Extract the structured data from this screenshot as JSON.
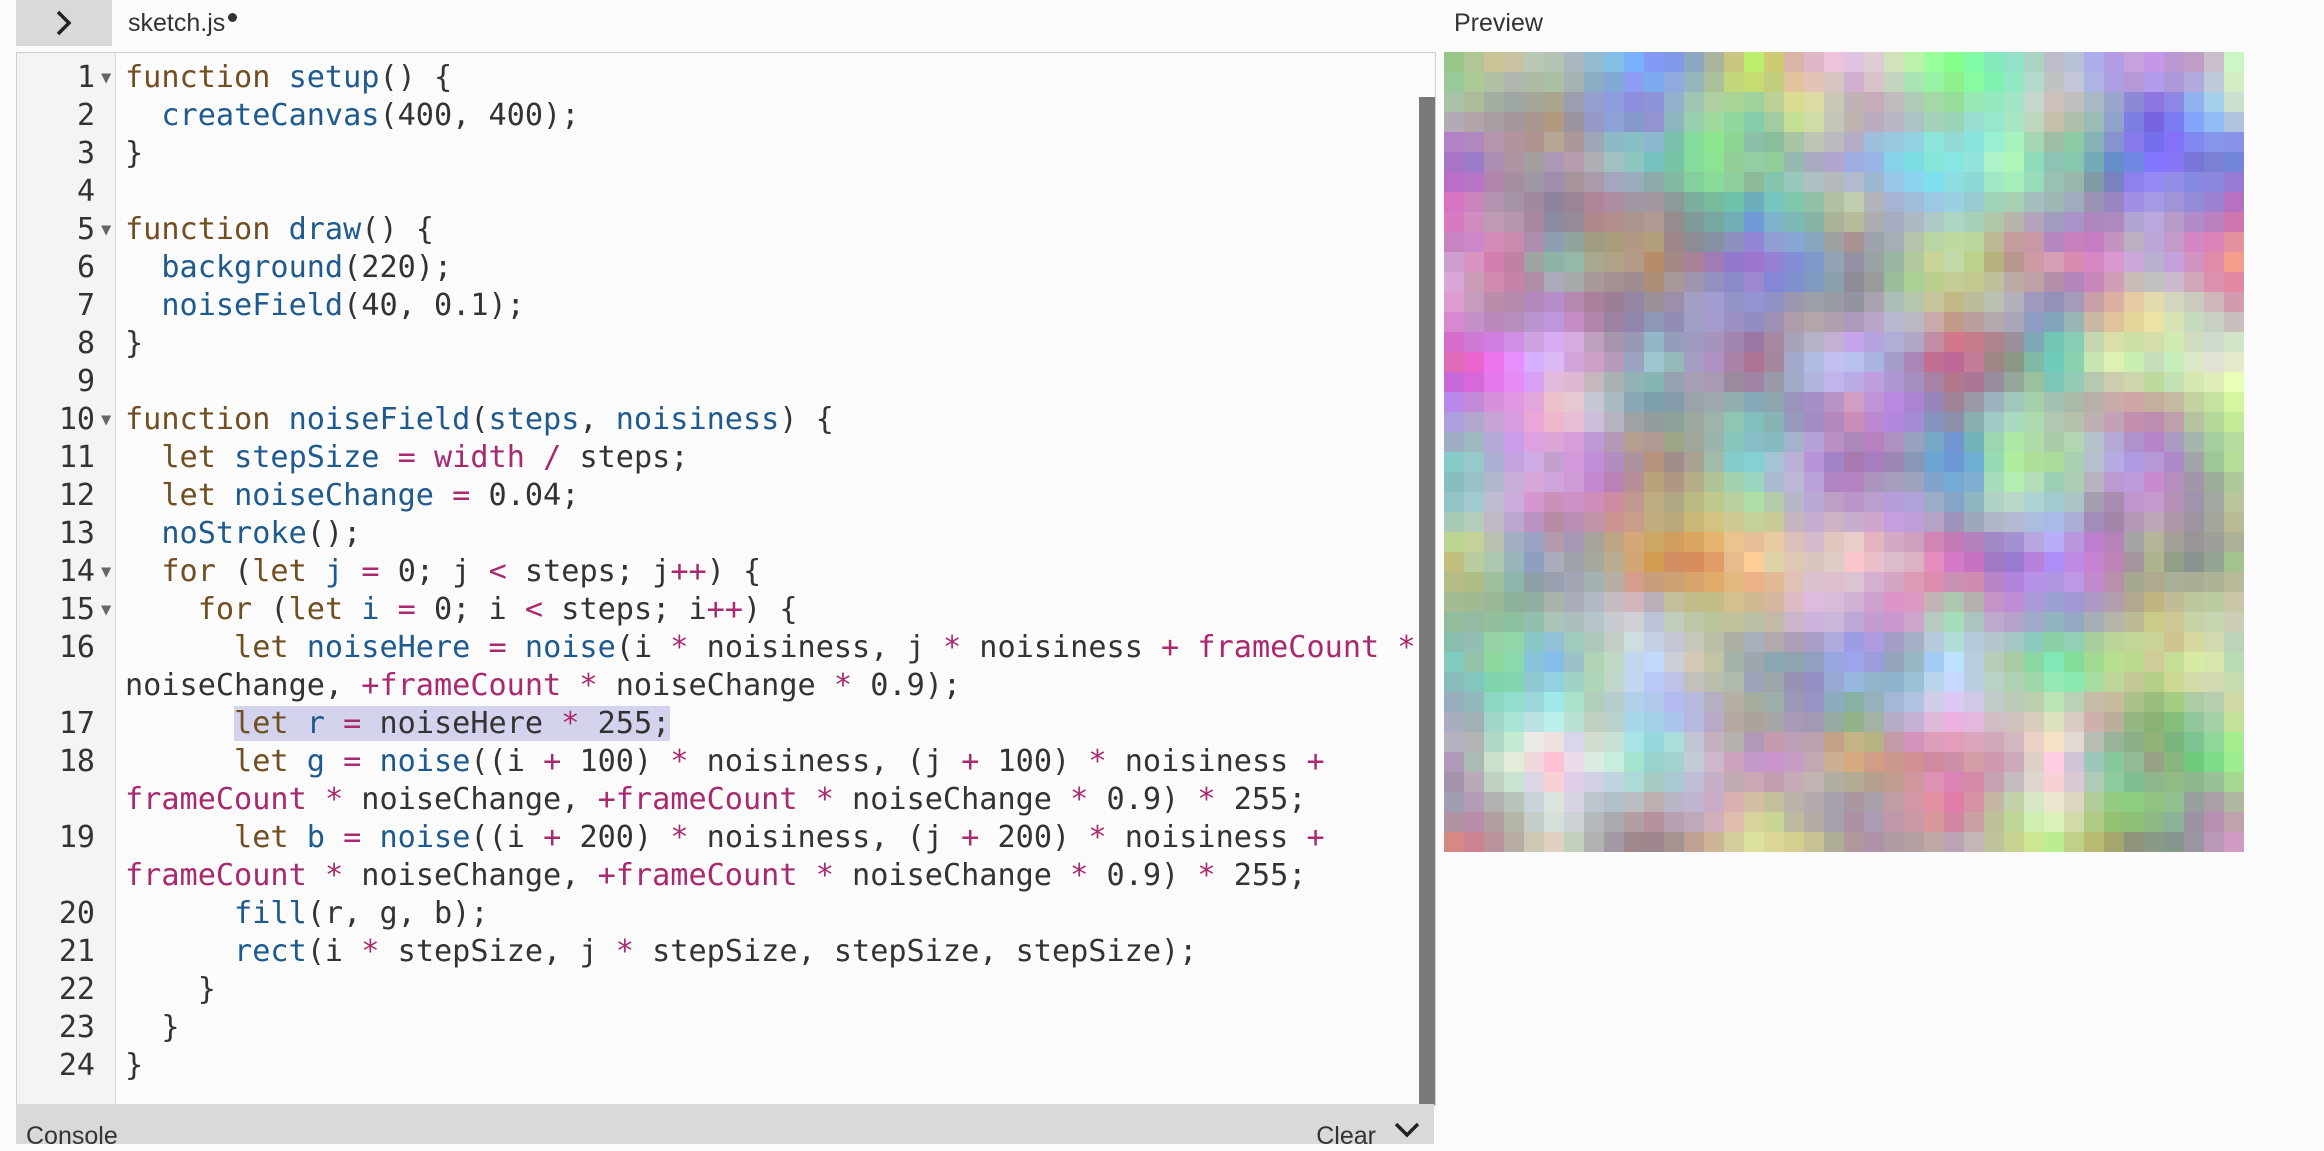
{
  "header": {
    "file_name": "sketch.js",
    "preview_label": "Preview"
  },
  "console": {
    "label": "Console",
    "clear_label": "Clear"
  },
  "editor": {
    "highlighted_line": 17,
    "lines": [
      {
        "n": "1",
        "fold": true,
        "t": [
          [
            "k",
            "function "
          ],
          [
            "f",
            "setup"
          ],
          [
            "",
            "() {"
          ]
        ]
      },
      {
        "n": "2",
        "t": [
          [
            "",
            "  "
          ],
          [
            "f",
            "createCanvas"
          ],
          [
            "",
            "(400, 400);"
          ]
        ]
      },
      {
        "n": "3",
        "t": [
          [
            "",
            "}"
          ]
        ]
      },
      {
        "n": "4",
        "t": []
      },
      {
        "n": "5",
        "fold": true,
        "t": [
          [
            "k",
            "function "
          ],
          [
            "f",
            "draw"
          ],
          [
            "",
            "() {"
          ]
        ]
      },
      {
        "n": "6",
        "t": [
          [
            "",
            "  "
          ],
          [
            "f",
            "background"
          ],
          [
            "",
            "(220);"
          ]
        ]
      },
      {
        "n": "7",
        "t": [
          [
            "",
            "  "
          ],
          [
            "f",
            "noiseField"
          ],
          [
            "",
            "(40, 0.1);"
          ]
        ]
      },
      {
        "n": "8",
        "t": [
          [
            "",
            "}"
          ]
        ]
      },
      {
        "n": "9",
        "t": []
      },
      {
        "n": "10",
        "fold": true,
        "t": [
          [
            "k",
            "function "
          ],
          [
            "f",
            "noiseField"
          ],
          [
            "",
            "("
          ],
          [
            "f",
            "steps"
          ],
          [
            "",
            ", "
          ],
          [
            "f",
            "noisiness"
          ],
          [
            "",
            ") {"
          ]
        ]
      },
      {
        "n": "11",
        "t": [
          [
            "",
            "  "
          ],
          [
            "k",
            "let "
          ],
          [
            "f",
            "stepSize"
          ],
          [
            "",
            " "
          ],
          [
            "p",
            "="
          ],
          [
            "",
            " "
          ],
          [
            "p",
            "width"
          ],
          [
            "",
            " "
          ],
          [
            "p",
            "/"
          ],
          [
            "",
            " steps;"
          ]
        ]
      },
      {
        "n": "12",
        "t": [
          [
            "",
            "  "
          ],
          [
            "k",
            "let "
          ],
          [
            "f",
            "noiseChange"
          ],
          [
            "",
            " "
          ],
          [
            "p",
            "="
          ],
          [
            "",
            " 0.04;"
          ]
        ]
      },
      {
        "n": "13",
        "t": [
          [
            "",
            "  "
          ],
          [
            "f",
            "noStroke"
          ],
          [
            "",
            "();"
          ]
        ]
      },
      {
        "n": "14",
        "fold": true,
        "t": [
          [
            "",
            "  "
          ],
          [
            "k",
            "for"
          ],
          [
            "",
            " ("
          ],
          [
            "k",
            "let "
          ],
          [
            "f",
            "j"
          ],
          [
            "",
            " "
          ],
          [
            "p",
            "="
          ],
          [
            "",
            " 0; j "
          ],
          [
            "p",
            "<"
          ],
          [
            "",
            " steps; j"
          ],
          [
            "p",
            "++"
          ],
          [
            "",
            ") {"
          ]
        ]
      },
      {
        "n": "15",
        "fold": true,
        "t": [
          [
            "",
            "    "
          ],
          [
            "k",
            "for"
          ],
          [
            "",
            " ("
          ],
          [
            "k",
            "let "
          ],
          [
            "f",
            "i"
          ],
          [
            "",
            " "
          ],
          [
            "p",
            "="
          ],
          [
            "",
            " 0; i "
          ],
          [
            "p",
            "<"
          ],
          [
            "",
            " steps; i"
          ],
          [
            "p",
            "++"
          ],
          [
            "",
            ") {"
          ]
        ]
      },
      {
        "n": "16",
        "t": [
          [
            "",
            "      "
          ],
          [
            "k",
            "let "
          ],
          [
            "f",
            "noiseHere"
          ],
          [
            "",
            " "
          ],
          [
            "p",
            "="
          ],
          [
            "",
            " "
          ],
          [
            "f",
            "noise"
          ],
          [
            "",
            "(i "
          ],
          [
            "p",
            "*"
          ],
          [
            "",
            " noisiness, j "
          ],
          [
            "p",
            "*"
          ],
          [
            "",
            " noisiness "
          ],
          [
            "p",
            "+"
          ],
          [
            "",
            " "
          ],
          [
            "p",
            "frameCount"
          ],
          [
            "",
            " "
          ],
          [
            "p",
            "*"
          ]
        ],
        "c": [
          [
            "",
            "noiseChange, "
          ],
          [
            "p",
            "+frameCount"
          ],
          [
            "",
            " "
          ],
          [
            "p",
            "*"
          ],
          [
            "",
            " noiseChange "
          ],
          [
            "p",
            "*"
          ],
          [
            "",
            " 0.9);"
          ]
        ]
      },
      {
        "n": "17",
        "t": [
          [
            "",
            "      "
          ],
          [
            "k",
            "let "
          ],
          [
            "f",
            "r"
          ],
          [
            "",
            " "
          ],
          [
            "p",
            "="
          ],
          [
            "",
            " noiseHere "
          ],
          [
            "p",
            "*"
          ],
          [
            "",
            " 255;"
          ]
        ]
      },
      {
        "n": "18",
        "t": [
          [
            "",
            "      "
          ],
          [
            "k",
            "let "
          ],
          [
            "f",
            "g"
          ],
          [
            "",
            " "
          ],
          [
            "p",
            "="
          ],
          [
            "",
            " "
          ],
          [
            "f",
            "noise"
          ],
          [
            "",
            "((i "
          ],
          [
            "p",
            "+"
          ],
          [
            "",
            " 100) "
          ],
          [
            "p",
            "*"
          ],
          [
            "",
            " noisiness, (j "
          ],
          [
            "p",
            "+"
          ],
          [
            "",
            " 100) "
          ],
          [
            "p",
            "*"
          ],
          [
            "",
            " noisiness "
          ],
          [
            "p",
            "+"
          ]
        ],
        "c": [
          [
            "p",
            "frameCount"
          ],
          [
            "",
            " "
          ],
          [
            "p",
            "*"
          ],
          [
            "",
            " noiseChange, "
          ],
          [
            "p",
            "+frameCount"
          ],
          [
            "",
            " "
          ],
          [
            "p",
            "*"
          ],
          [
            "",
            " noiseChange "
          ],
          [
            "p",
            "*"
          ],
          [
            "",
            " 0.9) "
          ],
          [
            "p",
            "*"
          ],
          [
            "",
            " 255;"
          ]
        ]
      },
      {
        "n": "19",
        "t": [
          [
            "",
            "      "
          ],
          [
            "k",
            "let "
          ],
          [
            "f",
            "b"
          ],
          [
            "",
            " "
          ],
          [
            "p",
            "="
          ],
          [
            "",
            " "
          ],
          [
            "f",
            "noise"
          ],
          [
            "",
            "((i "
          ],
          [
            "p",
            "+"
          ],
          [
            "",
            " 200) "
          ],
          [
            "p",
            "*"
          ],
          [
            "",
            " noisiness, (j "
          ],
          [
            "p",
            "+"
          ],
          [
            "",
            " 200) "
          ],
          [
            "p",
            "*"
          ],
          [
            "",
            " noisiness "
          ],
          [
            "p",
            "+"
          ]
        ],
        "c": [
          [
            "p",
            "frameCount"
          ],
          [
            "",
            " "
          ],
          [
            "p",
            "*"
          ],
          [
            "",
            " noiseChange, "
          ],
          [
            "p",
            "+frameCount"
          ],
          [
            "",
            " "
          ],
          [
            "p",
            "*"
          ],
          [
            "",
            " noiseChange "
          ],
          [
            "p",
            "*"
          ],
          [
            "",
            " 0.9) "
          ],
          [
            "p",
            "*"
          ],
          [
            "",
            " 255;"
          ]
        ]
      },
      {
        "n": "20",
        "t": [
          [
            "",
            "      "
          ],
          [
            "f",
            "fill"
          ],
          [
            "",
            "(r, g, b);"
          ]
        ]
      },
      {
        "n": "21",
        "t": [
          [
            "",
            "      "
          ],
          [
            "f",
            "rect"
          ],
          [
            "",
            "(i "
          ],
          [
            "p",
            "*"
          ],
          [
            "",
            " stepSize, j "
          ],
          [
            "p",
            "*"
          ],
          [
            "",
            " stepSize, stepSize, stepSize);"
          ]
        ]
      },
      {
        "n": "22",
        "t": [
          [
            "",
            "    }"
          ]
        ]
      },
      {
        "n": "23",
        "t": [
          [
            "",
            "  }"
          ]
        ]
      },
      {
        "n": "24",
        "t": [
          [
            "",
            "}"
          ]
        ]
      }
    ]
  }
}
